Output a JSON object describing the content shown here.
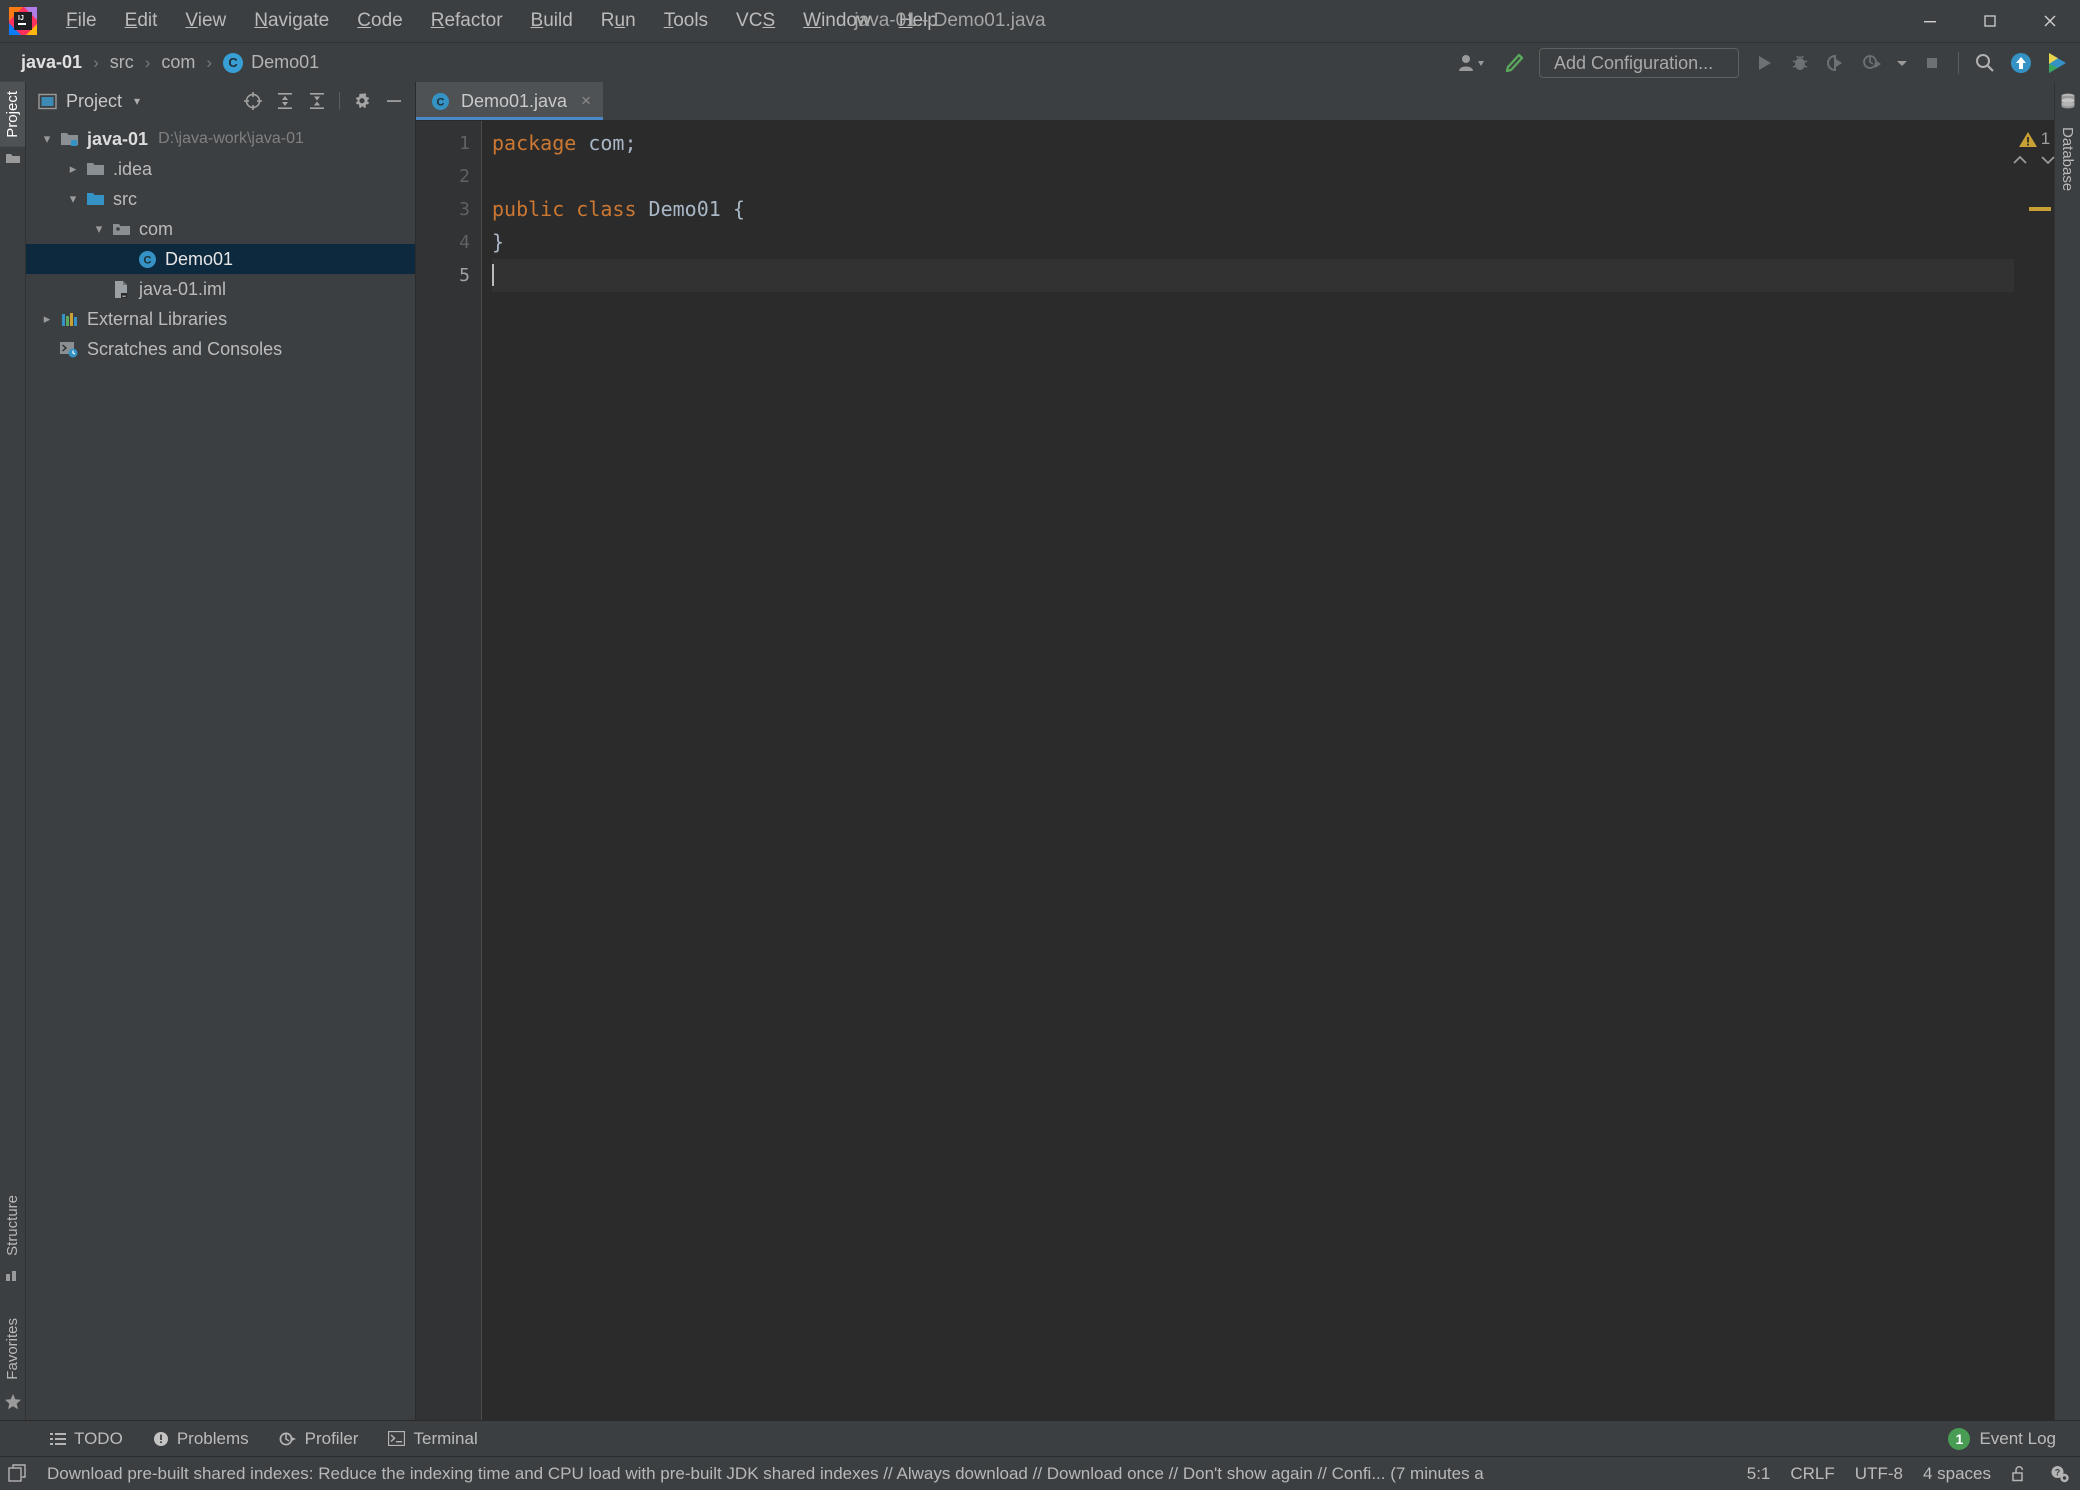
{
  "window": {
    "title": "java-01 - Demo01.java",
    "app_icon": "intellij-idea-logo",
    "minimize": "–",
    "maximize": "☐",
    "close": "×"
  },
  "menu": [
    {
      "label": "File",
      "mnemonic": "F"
    },
    {
      "label": "Edit",
      "mnemonic": "E"
    },
    {
      "label": "View",
      "mnemonic": "V"
    },
    {
      "label": "Navigate",
      "mnemonic": "N"
    },
    {
      "label": "Code",
      "mnemonic": "C"
    },
    {
      "label": "Refactor",
      "mnemonic": "R"
    },
    {
      "label": "Build",
      "mnemonic": "B"
    },
    {
      "label": "Run",
      "mnemonic": "u"
    },
    {
      "label": "Tools",
      "mnemonic": "T"
    },
    {
      "label": "VCS",
      "mnemonic": "S"
    },
    {
      "label": "Window",
      "mnemonic": "W"
    },
    {
      "label": "Help",
      "mnemonic": "H"
    }
  ],
  "navbar": {
    "breadcrumbs": [
      {
        "label": "java-01",
        "icon": ""
      },
      {
        "label": "src",
        "icon": ""
      },
      {
        "label": "com",
        "icon": ""
      },
      {
        "label": "Demo01",
        "icon": "class-badge",
        "badge": "C"
      }
    ],
    "separator": "›",
    "add_configuration_label": "Add Configuration...",
    "icons": [
      "user-avatar-icon",
      "chevron-down-icon",
      "build-hammer-icon",
      "run-icon",
      "debug-icon",
      "run-with-coverage-icon",
      "profiler-icon",
      "dropdown-arrow-icon",
      "stop-icon",
      "search-everywhere-icon",
      "update-project-icon",
      "run-anything-icon"
    ]
  },
  "left_strip": {
    "top": [
      {
        "label": "Project",
        "icon": "project-icon",
        "active": true
      }
    ],
    "bottom": [
      {
        "label": "Structure",
        "icon": "structure-icon",
        "active": false
      },
      {
        "label": "Favorites",
        "icon": "star-icon",
        "active": false
      }
    ]
  },
  "right_strip": {
    "items": [
      {
        "label": "Database",
        "icon": "database-icon",
        "active": false
      }
    ]
  },
  "project_panel": {
    "title": "Project",
    "view_icon": "project-view-icon",
    "caret": "▾",
    "actions": [
      "locate-crosshair-icon",
      "expand-all-icon",
      "collapse-all-icon",
      "settings-gear-icon",
      "hide-panel-icon"
    ],
    "tree": [
      {
        "label": "java-01",
        "sublabel": "D:\\java-work\\java-01",
        "icon": "project-folder-icon",
        "arrow": "expanded",
        "indent": 0,
        "bold": true,
        "selected": false
      },
      {
        "label": ".idea",
        "sublabel": "",
        "icon": "folder-icon",
        "arrow": "collapsed",
        "indent": 1,
        "bold": false,
        "selected": false
      },
      {
        "label": "src",
        "sublabel": "",
        "icon": "source-folder-icon",
        "arrow": "expanded",
        "indent": 1,
        "bold": false,
        "selected": false
      },
      {
        "label": "com",
        "sublabel": "",
        "icon": "package-icon",
        "arrow": "expanded",
        "indent": 2,
        "bold": false,
        "selected": false
      },
      {
        "label": "Demo01",
        "sublabel": "",
        "icon": "java-class-icon",
        "arrow": "none",
        "indent": 3,
        "bold": false,
        "selected": true
      },
      {
        "label": "java-01.iml",
        "sublabel": "",
        "icon": "iml-file-icon",
        "arrow": "none",
        "indent": 1,
        "bold": false,
        "selected": false
      },
      {
        "label": "External Libraries",
        "sublabel": "",
        "icon": "libraries-icon",
        "arrow": "collapsed",
        "indent": 0,
        "bold": false,
        "selected": false
      },
      {
        "label": "Scratches and Consoles",
        "sublabel": "",
        "icon": "scratches-icon",
        "arrow": "none",
        "indent": 0,
        "bold": false,
        "selected": false
      }
    ]
  },
  "editor": {
    "tabs": [
      {
        "label": "Demo01.java",
        "icon": "java-class-icon",
        "badge": "C",
        "active": true,
        "close": "×"
      }
    ],
    "lines": [
      {
        "number": "1",
        "tokens": [
          {
            "t": "package",
            "c": "kw"
          },
          {
            "t": " com;",
            "c": "pln"
          }
        ],
        "current": false
      },
      {
        "number": "2",
        "tokens": [
          {
            "t": "",
            "c": "pln"
          }
        ],
        "current": false
      },
      {
        "number": "3",
        "tokens": [
          {
            "t": "public class",
            "c": "kw"
          },
          {
            "t": " Demo01 {",
            "c": "cls"
          }
        ],
        "current": false
      },
      {
        "number": "4",
        "tokens": [
          {
            "t": "}",
            "c": "pln"
          }
        ],
        "current": false
      },
      {
        "number": "5",
        "tokens": [
          {
            "t": "",
            "c": "pln"
          }
        ],
        "current": true
      }
    ],
    "code_text": {
      "l1_kw": "package",
      "l1_rest": " com;",
      "l3_kw": "public class",
      "l3_rest": " Demo01 {",
      "l4": "}"
    },
    "inspection": {
      "warning_icon": "warning-triangle-icon",
      "warning_count": "1",
      "prev_icon": "⌃",
      "next_icon": "⌄"
    }
  },
  "bottom_tools": [
    {
      "label": "TODO",
      "icon": "todo-icon"
    },
    {
      "label": "Problems",
      "icon": "problems-icon"
    },
    {
      "label": "Profiler",
      "icon": "profiler-icon"
    },
    {
      "label": "Terminal",
      "icon": "terminal-icon"
    }
  ],
  "event_log": {
    "count": "1",
    "label": "Event Log"
  },
  "statusbar": {
    "notification_icon": "notification-icon",
    "message": "Download pre-built shared indexes: Reduce the indexing time and CPU load with pre-built JDK shared indexes // Always download // Download once // Don't show again // Confi... (7 minutes a",
    "caret_position": "5:1",
    "line_separator": "CRLF",
    "encoding": "UTF-8",
    "indent": "4 spaces",
    "lock_icon": "unlocked-icon",
    "inspection_icon": "inspection-level-icon"
  },
  "colors": {
    "chrome": "#3c3f41",
    "editor_bg": "#2b2b2b",
    "gutter_bg": "#313335",
    "selection": "#0d293e",
    "tab_active": "#4e5254",
    "accent_blue": "#4a88c7",
    "keyword_orange": "#cc7832",
    "text_default": "#a9b7c6",
    "warning_yellow": "#c8a033",
    "badge_green": "#499c54"
  }
}
